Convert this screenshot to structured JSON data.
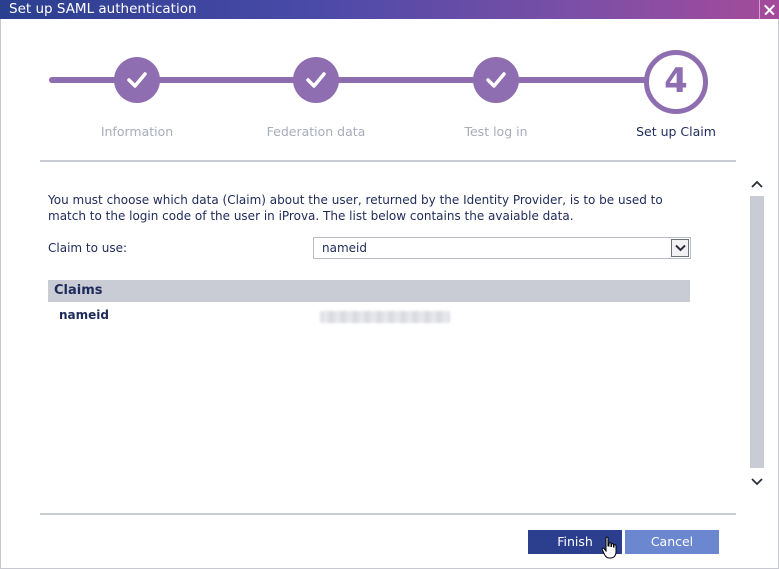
{
  "window": {
    "title": "Set up SAML authentication"
  },
  "wizard": {
    "steps": [
      {
        "label": "Information",
        "state": "complete"
      },
      {
        "label": "Federation data",
        "state": "complete"
      },
      {
        "label": "Test log in",
        "state": "complete"
      },
      {
        "label": "Set up Claim",
        "state": "current",
        "number": "4"
      }
    ]
  },
  "content": {
    "intro": "You must choose which data (Claim) about the user, returned by the Identity Provider, is to be used to match to the login code of the user in iProva. The list below contains the avaiable data.",
    "claim_label": "Claim to use:",
    "claim_selected": "nameid",
    "claims_header": "Claims",
    "claims": [
      {
        "name": "nameid"
      }
    ]
  },
  "buttons": {
    "finish": "Finish",
    "cancel": "Cancel"
  },
  "colors": {
    "accent": "#8e6db0",
    "primary_button": "#2c3f8e",
    "secondary_button": "#6a87cf",
    "text": "#1e2a5a"
  }
}
